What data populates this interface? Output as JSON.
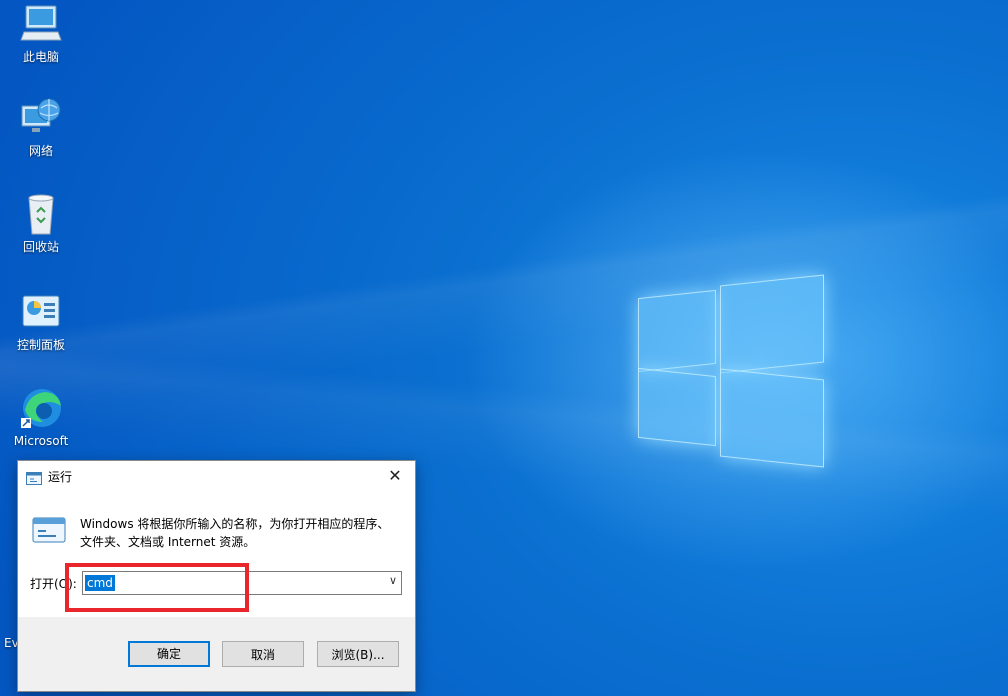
{
  "desktop": {
    "icons": [
      {
        "label": "此电脑",
        "icon": "this-pc-icon"
      },
      {
        "label": "网络",
        "icon": "network-icon"
      },
      {
        "label": "回收站",
        "icon": "recycle-bin-icon"
      },
      {
        "label": "控制面板",
        "icon": "control-panel-icon"
      },
      {
        "label": "Microsoft",
        "icon": "edge-icon"
      }
    ],
    "partial_label": "Ev"
  },
  "run_dialog": {
    "title": "运行",
    "description": "Windows 将根据你所输入的名称，为你打开相应的程序、文件夹、文档或 Internet 资源。",
    "open_label": "打开(O):",
    "open_value": "cmd",
    "buttons": {
      "ok": "确定",
      "cancel": "取消",
      "browse": "浏览(B)..."
    },
    "close_glyph": "✕"
  },
  "colors": {
    "accent": "#0078d7",
    "highlight": "#e8262b",
    "desktop_bg": "#0a6fd0"
  }
}
